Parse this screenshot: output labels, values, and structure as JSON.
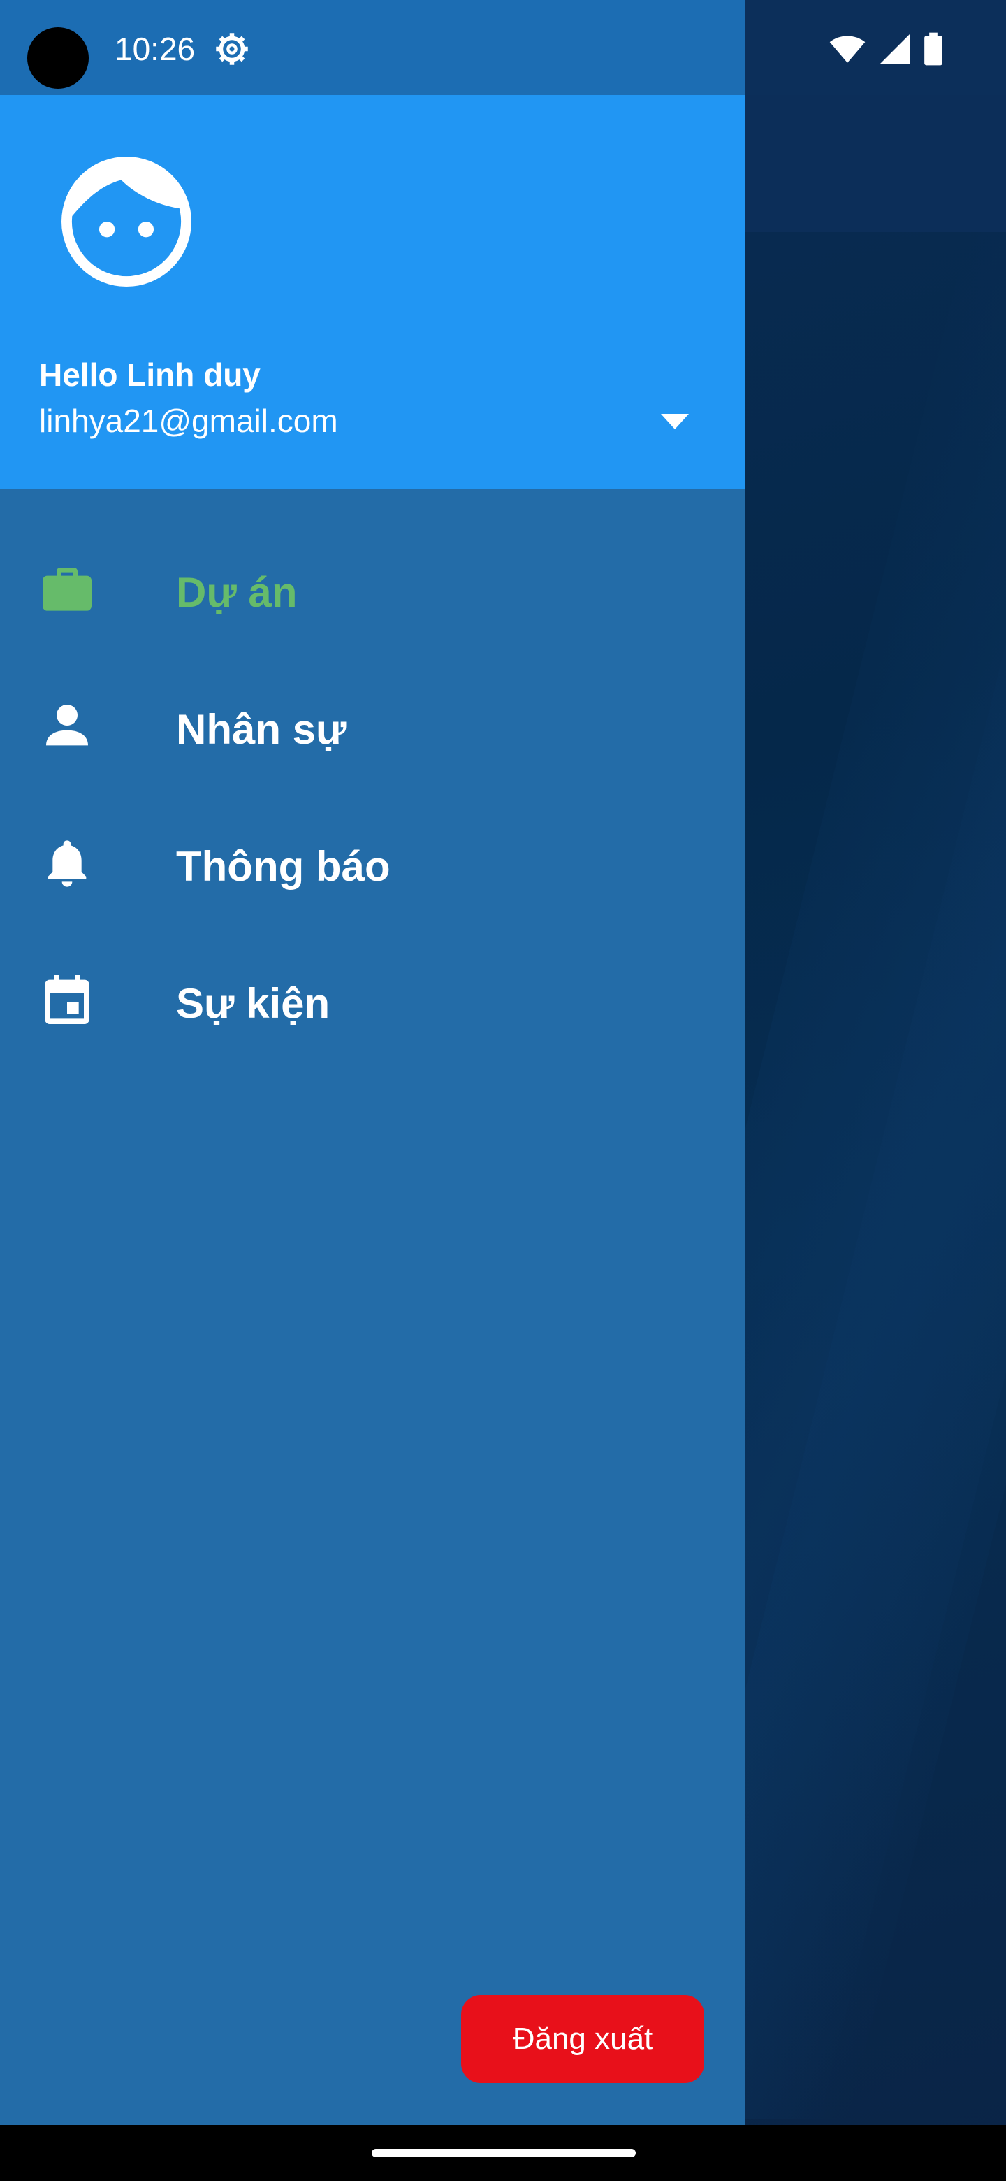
{
  "status_bar": {
    "time": "10:26",
    "icons": [
      "settings-gear-icon",
      "wifi-icon",
      "signal-icon",
      "battery-icon"
    ]
  },
  "drawer_header": {
    "avatar_icon": "face-icon",
    "greeting": "Hello Linh duy",
    "email": "linhya21@gmail.com",
    "dropdown_icon": "arrow-drop-down-icon"
  },
  "menu": {
    "items": [
      {
        "label": "Dự án",
        "icon": "briefcase-icon",
        "active": true
      },
      {
        "label": "Nhân sự",
        "icon": "person-icon",
        "active": false
      },
      {
        "label": "Thông báo",
        "icon": "bell-icon",
        "active": false
      },
      {
        "label": "Sự kiện",
        "icon": "calendar-event-icon",
        "active": false
      }
    ]
  },
  "logout": {
    "label": "Đăng xuất"
  },
  "colors": {
    "drawer_bg": "#236ca8",
    "header_bg": "#2196f3",
    "active_item": "#66bb6a",
    "logout_bg": "#e8101a"
  }
}
